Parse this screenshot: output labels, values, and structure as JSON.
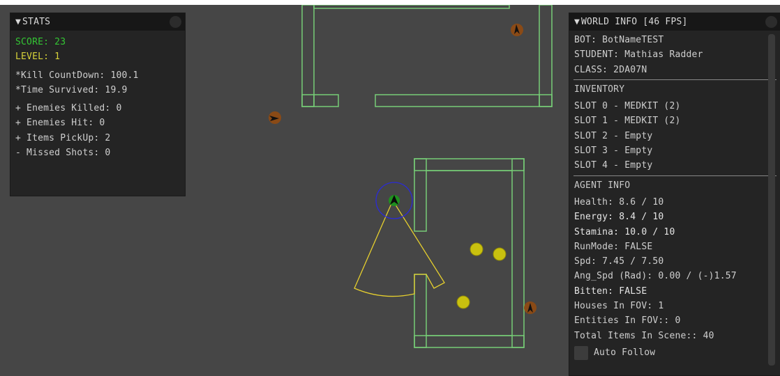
{
  "stats": {
    "title": "STATS",
    "score": "SCORE: 23",
    "level": "LEVEL: 1",
    "kill_countdown": "*Kill CountDown: 100.1",
    "time_survived": "*Time Survived: 19.9",
    "enemies_killed": "+ Enemies Killed: 0",
    "enemies_hit": "+ Enemies Hit: 0",
    "items_pickup": "+ Items PickUp: 2",
    "missed_shots": "- Missed Shots: 0"
  },
  "world_info": {
    "title": "WORLD INFO [46 FPS]",
    "bot": "BOT: BotNameTEST",
    "student": "STUDENT: Mathias Radder",
    "class": "CLASS: 2DA07N",
    "inventory_title": "INVENTORY",
    "slots": [
      "SLOT 0 - MEDKIT (2)",
      "SLOT 1 - MEDKIT (2)",
      "SLOT 2 - Empty",
      "SLOT 3 - Empty",
      "SLOT 4 - Empty"
    ],
    "agent_title": "AGENT INFO",
    "health": "Health: 8.6 / 10",
    "energy": "Energy: 8.4 / 10",
    "stamina": "Stamina: 10.0 / 10",
    "run_mode": "RunMode: FALSE",
    "speed": "Spd: 7.45 / 7.50",
    "ang_speed": "Ang_Spd (Rad): 0.00 / (-)1.57",
    "bitten": "Bitten: FALSE",
    "houses_fov": "Houses In FOV: 1",
    "entities_fov": "Entities In FOV:: 0",
    "total_items": "Total Items In Scene:: 40",
    "auto_follow": "Auto Follow"
  },
  "colors": {
    "background": "#464646",
    "wall": "#7ddc7d",
    "fov": "#e6cf2e",
    "agent_ring": "#2b2bd6",
    "agent": "#1f8f1f",
    "item": "#c9c10f",
    "enemy": "#8a4a16",
    "score": "#34c634",
    "level": "#d7d23a"
  }
}
